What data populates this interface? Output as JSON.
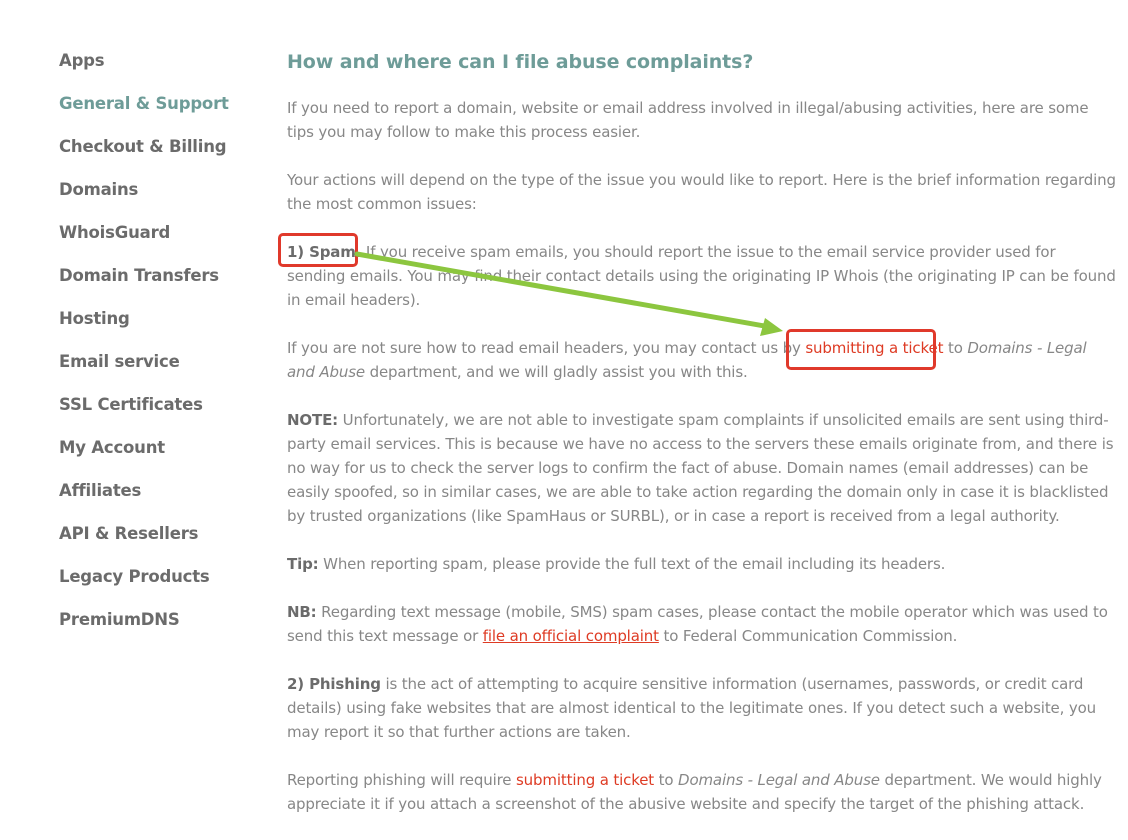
{
  "sidebar": {
    "items": [
      {
        "label": "Apps",
        "active": false
      },
      {
        "label": "General & Support",
        "active": true
      },
      {
        "label": "Checkout & Billing",
        "active": false
      },
      {
        "label": "Domains",
        "active": false
      },
      {
        "label": "WhoisGuard",
        "active": false
      },
      {
        "label": "Domain Transfers",
        "active": false
      },
      {
        "label": "Hosting",
        "active": false
      },
      {
        "label": "Email service",
        "active": false
      },
      {
        "label": "SSL Certificates",
        "active": false
      },
      {
        "label": "My Account",
        "active": false
      },
      {
        "label": "Affiliates",
        "active": false
      },
      {
        "label": "API & Resellers",
        "active": false
      },
      {
        "label": "Legacy Products",
        "active": false
      },
      {
        "label": "PremiumDNS",
        "active": false
      }
    ]
  },
  "article": {
    "title": "How and where can I file abuse complaints?",
    "intro": "If you need to report a domain, website or email address involved in illegal/abusing activities, here are some tips you may follow to make this process easier.",
    "actions": "Your actions will depend on the type of the issue you would like to report. Here is the brief information regarding the most common issues:",
    "spam": {
      "label": "1) Spam.",
      "text": " If you receive spam emails, you should report the issue to the email service provider used for sending emails. You may find their contact details using the originating IP Whois (the originating IP can be found in email headers)."
    },
    "headers": {
      "before": "If you are not sure how to read email headers, you may contact us by ",
      "link": "submitting a ticket",
      "middle": " to ",
      "dept": "Domains - Legal and Abuse",
      "after": " department, and we will gladly assist you with this."
    },
    "note": {
      "label": "NOTE:",
      "text": " Unfortunately, we are not able to investigate spam complaints if unsolicited emails are sent using third-party email services. This is because we have no access to the servers these emails originate from, and there is no way for us to check the server logs to confirm the fact of abuse. Domain names (email addresses) can be easily spoofed, so in similar cases, we are able to take action regarding the domain only in case it is blacklisted by trusted organizations (like SpamHaus or SURBL), or in case a report is received from a legal authority."
    },
    "tip": {
      "label": "Tip:",
      "text": " When reporting spam, please provide the full text of the email including its headers."
    },
    "nb": {
      "label": "NB:",
      "before": " Regarding text message (mobile, SMS) spam cases, please contact the mobile operator which was used to send this text message or ",
      "link": "file an official complaint",
      "after": " to Federal Communication Commission."
    },
    "phishing": {
      "label": "2) Phishing",
      "text": " is the act of attempting to acquire sensitive information (usernames, passwords, or credit card details) using fake websites that are almost identical to the legitimate ones. If you detect such a website, you may report it so that further actions are taken."
    },
    "phishing_report": {
      "before": "Reporting phishing will require ",
      "link": "submitting a ticket",
      "middle": " to ",
      "dept": "Domains - Legal and Abuse",
      "after": " department. We would highly appreciate it if you attach a screenshot of the abusive website and specify the target of the phishing attack."
    }
  },
  "colors": {
    "accent": "#6e9c98",
    "text": "#878787",
    "bold_text": "#6b6b6b",
    "link": "#de3b24",
    "annotation_box": "#e0392b",
    "annotation_arrow": "#8cc63f"
  }
}
